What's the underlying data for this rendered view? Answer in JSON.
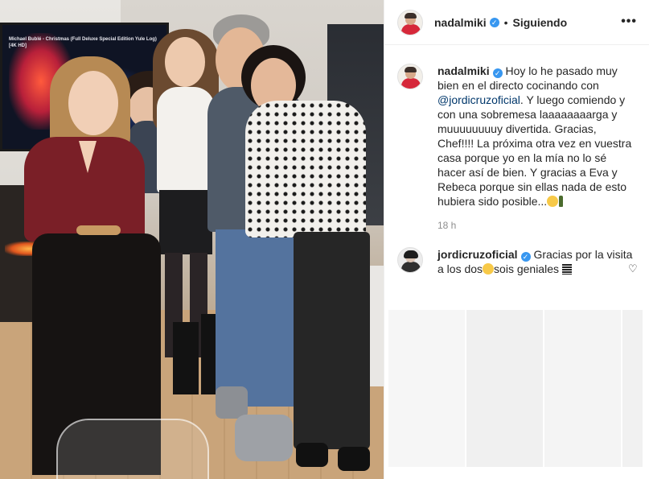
{
  "photo": {
    "tv_text": "Michael Bublé - Christmas (Full Deluxe Special Edition Yule Log) [4K HD]"
  },
  "post": {
    "author": "nadalmiki",
    "follow_status": "Siguiendo",
    "caption_text": "Hoy lo he pasado muy bien en el directo cocinando con",
    "caption_mention": "@jordicruzoficial",
    "caption_rest": ". Y luego comiendo y con una sobremesa laaaaaaaarga y muuuuuuuuy divertida. Gracias, Chef!!!! La próxima otra vez en vuestra casa porque yo en la mía no lo sé hacer así de bien. Y gracias a Eva y Rebeca porque sin ellas nada de esto hubiera sido posible...",
    "time": "18 h"
  },
  "comments": [
    {
      "author": "jordicruzoficial",
      "text_before": "Gracias por la visita a los dos",
      "text_after": "sois geniales"
    }
  ],
  "icons": {
    "verified": "verified-badge-icon",
    "more": "more-options-icon",
    "like": "heart-icon"
  },
  "colors": {
    "verified_blue": "#3897f0",
    "mention": "#00376b",
    "timestamp": "#8e8e8e"
  }
}
